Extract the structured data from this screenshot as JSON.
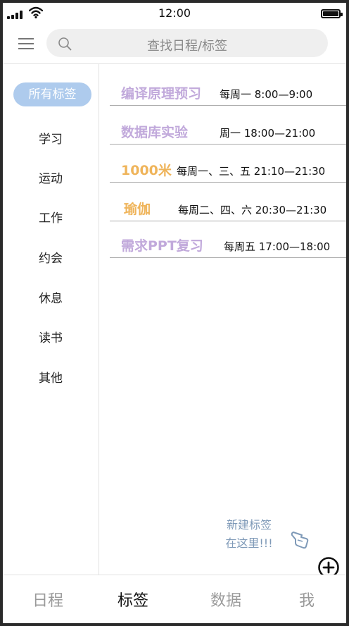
{
  "status_bar": {
    "time": "12:00"
  },
  "header": {
    "search_placeholder": "查找日程/标签"
  },
  "sidebar": {
    "selected_tag": "所有标签",
    "items": [
      "学习",
      "运动",
      "工作",
      "约会",
      "休息",
      "读书",
      "其他"
    ]
  },
  "schedules": [
    {
      "title": "编译原理预习",
      "time": "每周一  8:00—9:00",
      "color": "#c1a9db"
    },
    {
      "title": "数据库实验",
      "time": "周一  18:00—21:00",
      "color": "#c1a9db"
    },
    {
      "title": "1000米",
      "time": "每周一、三、五 21:10—21:30",
      "color": "#efb45a"
    },
    {
      "title": "瑜伽",
      "time": "每周二、四、六 20:30—21:30",
      "color": "#efb45a"
    },
    {
      "title": "需求PPT复习",
      "time": "每周五  17:00—18:00",
      "color": "#c1a9db"
    }
  ],
  "hint": {
    "line1": "新建标签",
    "line2": "在这里!!!"
  },
  "tabbar": {
    "tabs": [
      {
        "label": "日程",
        "active": false
      },
      {
        "label": "标签",
        "active": true
      },
      {
        "label": "数据",
        "active": false
      },
      {
        "label": "我",
        "active": false
      }
    ]
  },
  "colors": {
    "accent_blue": "#aecbed",
    "hint_blue": "#7f9ab8",
    "lavender": "#c1a9db",
    "orange": "#efb45a"
  }
}
